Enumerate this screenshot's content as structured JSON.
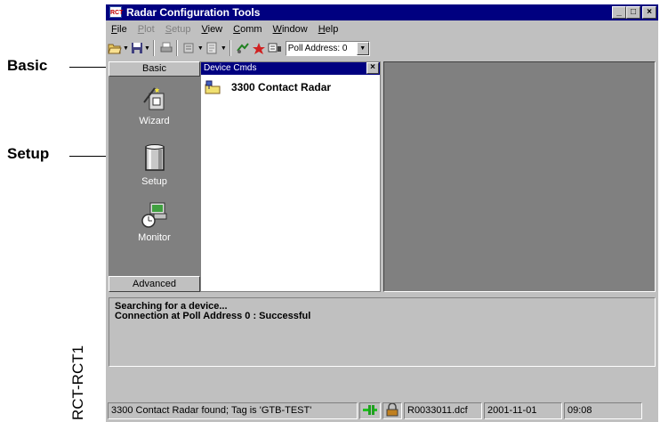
{
  "callouts": {
    "basic": "Basic",
    "setup": "Setup"
  },
  "figure_label": "RCT-RCT1",
  "app": {
    "icon_text": "RCT",
    "title": "Radar Configuration Tools",
    "window_buttons": [
      "_",
      "□",
      "×"
    ]
  },
  "menu": [
    {
      "label": "File",
      "enabled": true
    },
    {
      "label": "Plot",
      "enabled": false
    },
    {
      "label": "Setup",
      "enabled": false
    },
    {
      "label": "View",
      "enabled": true
    },
    {
      "label": "Comm",
      "enabled": true
    },
    {
      "label": "Window",
      "enabled": true
    },
    {
      "label": "Help",
      "enabled": true
    }
  ],
  "toolbar": {
    "poll_address": "Poll Address: 0",
    "icons": [
      "open-folder-icon",
      "save-icon",
      "print-icon",
      "device-icon",
      "document-icon",
      "connect-icon",
      "alarm-icon",
      "comm-icon"
    ]
  },
  "sidebar": {
    "header": "Basic",
    "footer": "Advanced",
    "items": [
      {
        "label": "Wizard",
        "icon": "wizard-icon"
      },
      {
        "label": "Setup",
        "icon": "setup-icon"
      },
      {
        "label": "Monitor",
        "icon": "monitor-icon"
      }
    ]
  },
  "device_cmds": {
    "title": "Device Cmds",
    "close": "×",
    "tree_root": "3300 Contact Radar"
  },
  "output": {
    "lines": [
      "Searching for a device...",
      "Connection at Poll Address 0 : Successful"
    ]
  },
  "status": {
    "message": "3300 Contact Radar found; Tag is 'GTB-TEST'",
    "file": "R0033011.dcf",
    "date": "2001-11-01",
    "time": "09:08"
  },
  "colors": {
    "titlebar": "#000080",
    "face": "#c0c0c0",
    "workspace": "#808080"
  }
}
